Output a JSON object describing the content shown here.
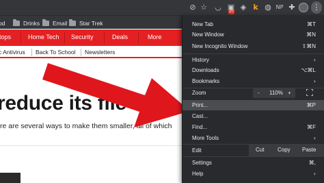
{
  "bookmarks_bar": {
    "items": [
      {
        "label": "od"
      },
      {
        "label": "Drinks"
      },
      {
        "label": "Email"
      },
      {
        "label": "Star Trek"
      }
    ]
  },
  "toolbar": {
    "extensions": [
      {
        "icon": "eye-slash-icon",
        "glyph": "⊘"
      },
      {
        "icon": "star-icon",
        "glyph": "☆"
      },
      {
        "icon": "pocket-icon",
        "glyph": "◡"
      },
      {
        "icon": "adblock-icon",
        "glyph": "▣",
        "badge": "20"
      },
      {
        "icon": "lock-extension-icon",
        "glyph": "◈"
      },
      {
        "icon": "k-extension-icon",
        "glyph": "k"
      },
      {
        "icon": "grammarly-icon",
        "glyph": "◍"
      },
      {
        "icon": "np-extension-icon",
        "glyph": "NP"
      },
      {
        "icon": "puzzle-icon",
        "glyph": "✚"
      }
    ],
    "menu_glyph": "⋮"
  },
  "site": {
    "nav": [
      "tops",
      "Home Tech",
      "Security",
      "Deals",
      "More"
    ],
    "subnav": [
      "c Antivirus",
      "Back To School",
      "Newsletters"
    ],
    "headline": "reduce its file size",
    "subline": "re are several ways to make them smaller, all of which"
  },
  "chrome_menu": {
    "items": {
      "new_tab": {
        "label": "New Tab",
        "shortcut": "⌘T"
      },
      "new_window": {
        "label": "New Window",
        "shortcut": "⌘N"
      },
      "new_incognito": {
        "label": "New Incognito Window",
        "shortcut": "⇧⌘N"
      },
      "history": {
        "label": "History",
        "chevron": "›"
      },
      "downloads": {
        "label": "Downloads",
        "shortcut": "⌥⌘L"
      },
      "bookmarks": {
        "label": "Bookmarks",
        "chevron": "›"
      },
      "print": {
        "label": "Print...",
        "shortcut": "⌘P"
      },
      "cast": {
        "label": "Cast..."
      },
      "find": {
        "label": "Find...",
        "shortcut": "⌘F"
      },
      "more_tools": {
        "label": "More Tools",
        "chevron": "›"
      },
      "settings": {
        "label": "Settings",
        "shortcut": "⌘,"
      },
      "help": {
        "label": "Help",
        "chevron": "›"
      }
    },
    "zoom": {
      "label": "Zoom",
      "minus": "-",
      "value": "110%",
      "plus": "+"
    },
    "edit": {
      "label": "Edit",
      "cut": "Cut",
      "copy": "Copy",
      "paste": "Paste"
    }
  },
  "colors": {
    "site_red": "#e52023",
    "menu_bg": "#292a2d",
    "menu_highlight": "#4a4c50",
    "arrow_red": "#e0161d"
  }
}
